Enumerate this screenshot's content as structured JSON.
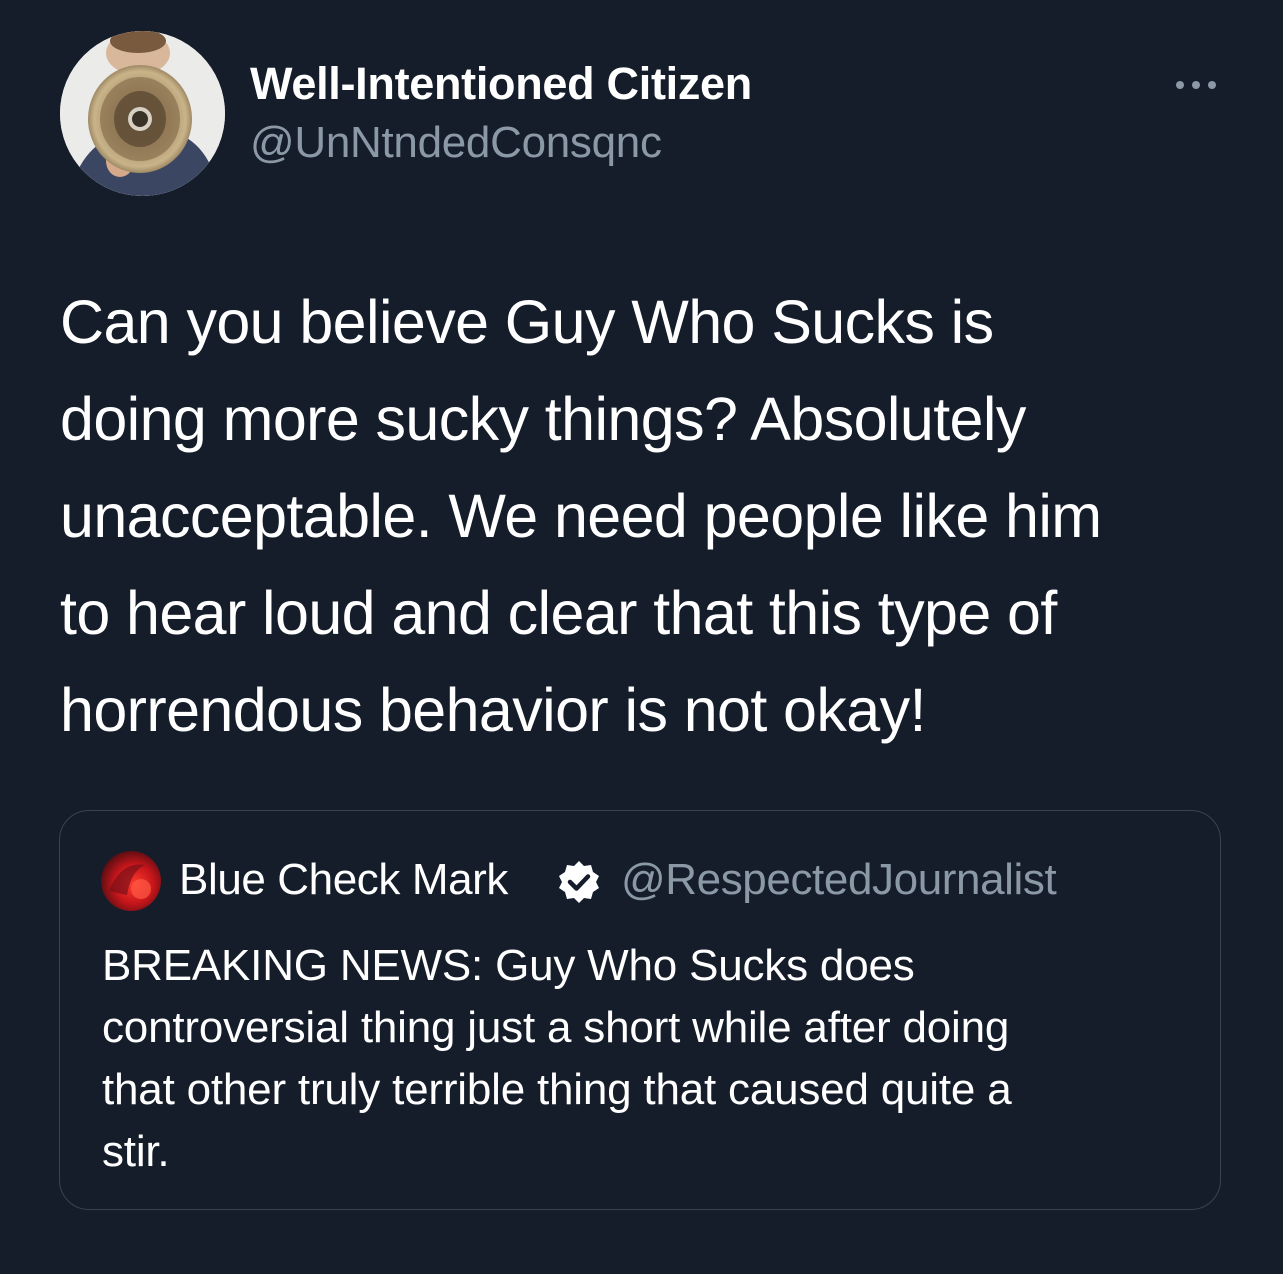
{
  "tweet": {
    "author": {
      "display_name": "Well-Intentioned Citizen",
      "handle": "@UnNtndedConsqnc",
      "avatar_icon": "megaphone-person-avatar"
    },
    "more_icon": "ellipsis-icon",
    "text": "Can you believe Guy Who Sucks is\ndoing more sucky things? Absolutely\nunacceptable. We need people like him\nto hear loud and clear that this type of\nhorrendous behavior is not okay!"
  },
  "quoted_tweet": {
    "author": {
      "display_name": "Blue Check Mark",
      "handle": "@RespectedJournalist",
      "verified_icon": "verified-badge-icon",
      "avatar_icon": "red-blur-avatar"
    },
    "text": "BREAKING NEWS: Guy Who Sucks does\ncontroversial thing just a short while after doing\nthat other truly terrible thing that caused quite a\nstir."
  },
  "colors": {
    "background": "#151d2a",
    "primary_text": "#ffffff",
    "secondary_text": "#8b98a5",
    "card_border": "#38444d"
  }
}
